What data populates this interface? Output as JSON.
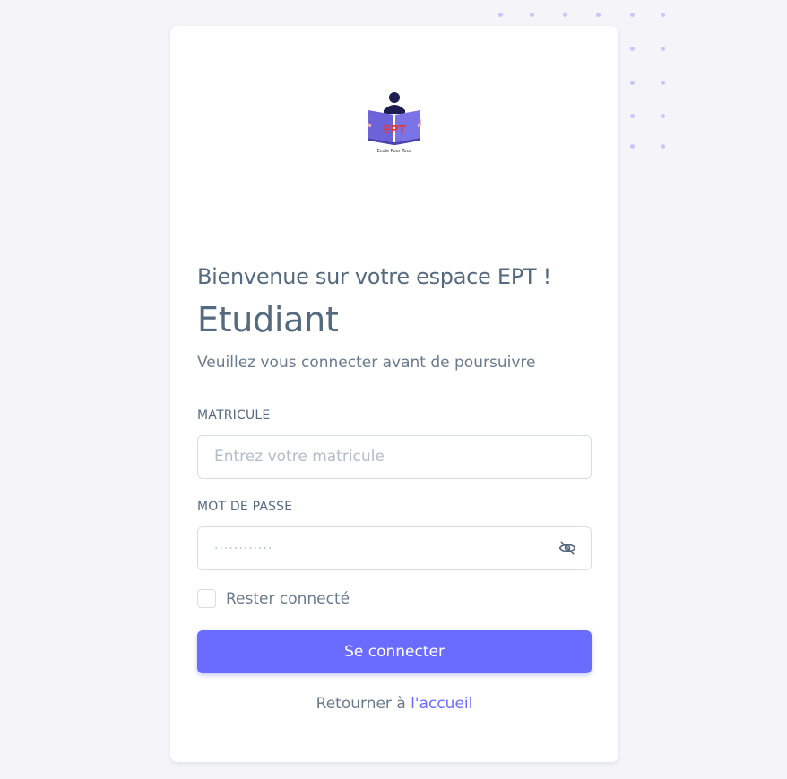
{
  "brand": {
    "logo_text": "EPT",
    "logo_tagline": "Ecole Pour Tous"
  },
  "header": {
    "welcome": "Bienvenue sur votre espace EPT !",
    "role": "Etudiant",
    "subtitle": "Veuillez vous connecter avant de poursuivre"
  },
  "form": {
    "matricule_label": "MATRICULE",
    "matricule_placeholder": "Entrez votre matricule",
    "matricule_value": "",
    "password_label": "MOT DE PASSE",
    "password_placeholder": "············",
    "password_value": "",
    "remember_label": "Rester connecté",
    "remember_checked": false,
    "submit_label": "Se connecter"
  },
  "footer": {
    "back_text": "Retourner à ",
    "back_link": "l'accueil"
  },
  "icons": {
    "password_toggle": "eye-off-icon",
    "logo": "reading-student-logo"
  },
  "colors": {
    "primary": "#696cff",
    "text": "#566a7f",
    "muted": "#697a8d",
    "background": "#f5f5f9",
    "decor_dots": "#c9c6fb"
  }
}
